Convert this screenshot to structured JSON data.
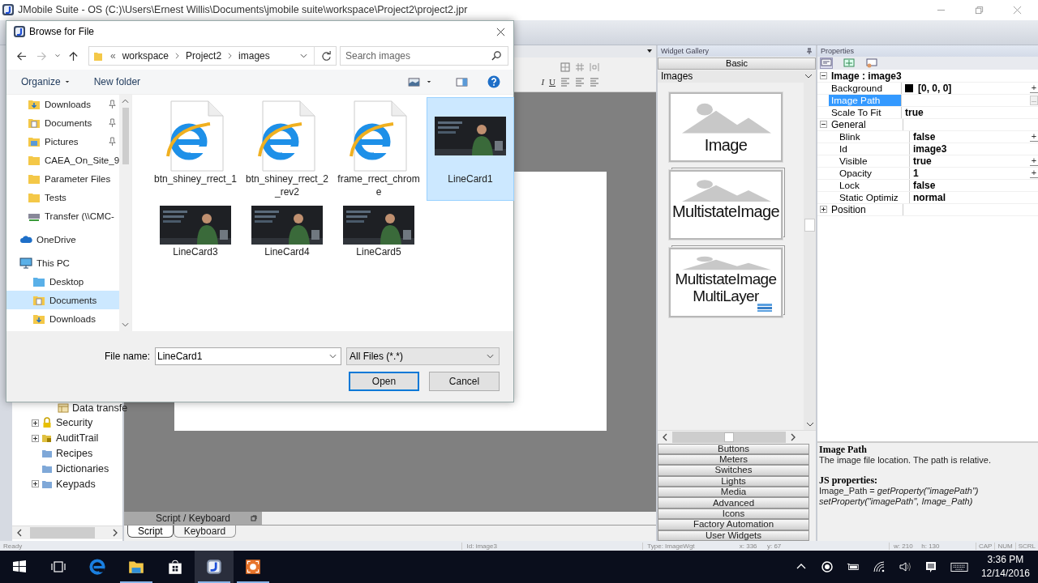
{
  "app": {
    "title": "JMobile Suite - OS (C:)\\Users\\Ernest Willis\\Documents\\jmobile suite\\workspace\\Project2\\project2.jpr"
  },
  "toolbar": {
    "format_buttons": [
      "I",
      "U"
    ]
  },
  "project_tree": [
    {
      "children": [
        {
          "label": "Data transfe",
          "kind": "leaf"
        }
      ]
    },
    {
      "label": "Security",
      "kind": "group"
    },
    {
      "label": "AuditTrail",
      "kind": "group"
    },
    {
      "label": "Recipes",
      "kind": "leaf"
    },
    {
      "label": "Dictionaries",
      "kind": "leaf"
    },
    {
      "label": "Keypads",
      "kind": "group"
    }
  ],
  "script_panel": {
    "title": "Script / Keyboard",
    "tabs": [
      {
        "label": "Script",
        "selected": true
      },
      {
        "label": "Keyboard",
        "selected": false
      }
    ]
  },
  "widget_gallery": {
    "title": "Widget Gallery",
    "tab": "Basic",
    "category": "Images",
    "widgets": [
      {
        "kind": "single",
        "lines": [
          "Image"
        ]
      },
      {
        "kind": "stack",
        "lines": [
          "MultistateImage"
        ]
      },
      {
        "kind": "layered",
        "lines": [
          "MultistateImage",
          "MultiLayer"
        ]
      }
    ],
    "groups": [
      "Buttons",
      "Meters",
      "Switches",
      "Lights",
      "Media",
      "Advanced",
      "Icons",
      "Factory Automation",
      "User Widgets"
    ]
  },
  "properties": {
    "title": "Properties",
    "rows": [
      {
        "kind": "group",
        "label": "Image : image3",
        "expanded": true,
        "children": [
          {
            "kind": "prop",
            "label": "Background",
            "value": "[0, 0, 0]",
            "color": "#000000",
            "button": "+",
            "selected": false
          },
          {
            "kind": "prop",
            "label": "Image Path",
            "button": "...",
            "selected": true
          },
          {
            "kind": "prop",
            "label": "Scale To Fit",
            "value": "true",
            "selected": false
          },
          {
            "kind": "group",
            "label": "General",
            "expanded": true,
            "children": [
              {
                "kind": "prop",
                "label": "Blink",
                "value": "false",
                "button": "+",
                "selected": false
              },
              {
                "kind": "prop",
                "label": "Id",
                "value": "image3",
                "selected": false
              },
              {
                "kind": "prop",
                "label": "Visible",
                "value": "true",
                "button": "+",
                "selected": false
              },
              {
                "kind": "prop",
                "label": "Opacity",
                "value": "1",
                "button": "+",
                "selected": false
              },
              {
                "kind": "prop",
                "label": "Lock",
                "value": "false",
                "selected": false
              },
              {
                "kind": "prop",
                "label": "Static Optimiz",
                "value": "normal",
                "selected": false
              }
            ]
          },
          {
            "kind": "group",
            "label": "Position",
            "expanded": false
          }
        ]
      }
    ],
    "help": {
      "title": "Image Path",
      "text": "The image file location.  The path is relative.",
      "js_title": "JS properties:",
      "js_lines": [
        {
          "text": "Image_Path = *getProperty(\"imagePath\")*",
          "italic": false
        },
        {
          "text": "setProperty(\"imagePath\", Image_Path)",
          "italic": true
        }
      ]
    }
  },
  "status_bar": {
    "message": "Ready",
    "fields": [
      "Id: image3",
      "Type: ImageWgt",
      "x: 336",
      "y: 67",
      "w: 210",
      "h: 130"
    ],
    "keys": [
      "CAP",
      "NUM",
      "SCRL"
    ]
  },
  "dialog": {
    "title": "Browse for File",
    "overflow": "«",
    "path": [
      "workspace",
      "Project2",
      "images"
    ],
    "search_placeholder": "Search images",
    "organize": "Organize",
    "new_folder": "New folder",
    "nav": [
      {
        "label": "Downloads",
        "pinned": true,
        "selected": false
      },
      {
        "label": "Documents",
        "pinned": true,
        "selected": false
      },
      {
        "label": "Pictures",
        "pinned": true,
        "selected": false
      },
      {
        "label": "CAEA_On_Site_9",
        "pinned": false,
        "selected": false
      },
      {
        "label": "Parameter Files",
        "pinned": false,
        "selected": false
      },
      {
        "label": "Tests",
        "pinned": false,
        "selected": false
      },
      {
        "label": "Transfer (\\\\CMC-",
        "pinned": false,
        "selected": false
      },
      {
        "label": "OneDrive",
        "pinned": false,
        "selected": false
      },
      {
        "label": "This PC",
        "pinned": false,
        "selected": false,
        "children": [
          {
            "label": "Desktop",
            "pinned": false,
            "selected": false
          },
          {
            "label": "Documents",
            "pinned": false,
            "selected": true
          },
          {
            "label": "Downloads",
            "pinned": false,
            "selected": false
          }
        ]
      }
    ],
    "files": [
      {
        "name": "btn_shiney_rrect_1",
        "kind": "web",
        "selected": false
      },
      {
        "name": "btn_shiney_rrect_2_rev2",
        "kind": "web",
        "selected": false
      },
      {
        "name": "frame_rrect_chrome",
        "kind": "web",
        "selected": false
      },
      {
        "name": "LineCard1",
        "selected": true
      },
      {
        "name": "LineCard3",
        "selected": false
      },
      {
        "name": "LineCard4",
        "selected": false
      },
      {
        "name": "LineCard5",
        "selected": false
      }
    ],
    "file_name_label": "File name:",
    "file_name": "LineCard1",
    "file_type": "All Files (*.*)",
    "buttons": [
      {
        "label": "Open",
        "default": true
      },
      {
        "label": "Cancel",
        "default": false
      }
    ]
  },
  "taskbar": {
    "apps": [
      {
        "kind": "edge",
        "running": false,
        "selected": false
      },
      {
        "kind": "explorer",
        "running": true,
        "selected": false
      },
      {
        "kind": "store",
        "running": false,
        "selected": false
      },
      {
        "kind": "jmobile",
        "running": true,
        "selected": true
      },
      {
        "kind": "capture",
        "running": true,
        "selected": false
      }
    ],
    "time": "3:36 PM",
    "date": "12/14/2016"
  }
}
